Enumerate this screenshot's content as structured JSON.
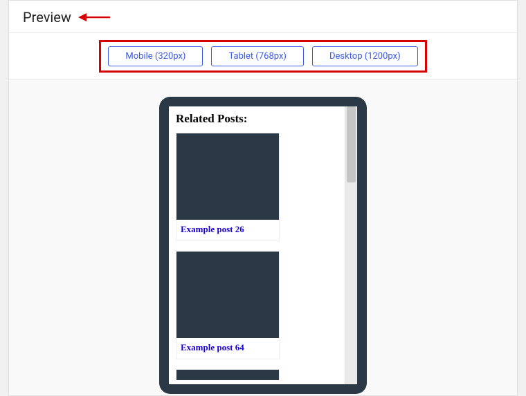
{
  "header": {
    "title": "Preview"
  },
  "toolbar": {
    "mobile_label": "Mobile (320px)",
    "tablet_label": "Tablet (768px)",
    "desktop_label": "Desktop (1200px)"
  },
  "preview": {
    "related_heading": "Related Posts:",
    "posts": [
      {
        "title": "Example post 26"
      },
      {
        "title": "Example post 64"
      }
    ]
  },
  "annotation": {
    "arrow_color": "#d60000",
    "box_color": "#d60000"
  }
}
